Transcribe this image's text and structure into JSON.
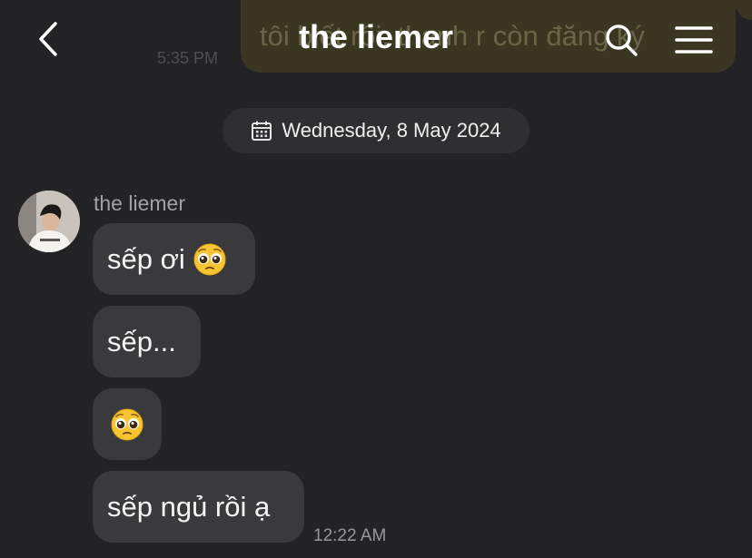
{
  "previous_message": {
    "text": "tôi biết rồi, thanh r còn đăng ký",
    "time": "5:35 PM"
  },
  "header": {
    "title": "the liemer",
    "back_icon": "chevron-left-icon",
    "search_icon": "search-icon",
    "menu_icon": "hamburger-menu-icon"
  },
  "date_separator": {
    "icon": "calendar-icon",
    "text": "Wednesday, 8 May 2024"
  },
  "conversation": {
    "sender_name": "the liemer",
    "messages": [
      {
        "text": "sếp ơi",
        "emoji": "pleading-face"
      },
      {
        "text": "sếp..."
      },
      {
        "text": "",
        "emoji": "pleading-face"
      },
      {
        "text": "sếp ngủ rồi ạ"
      }
    ],
    "last_time": "12:22 AM"
  },
  "colors": {
    "background": "#232325",
    "bubble": "#3a3a3c",
    "date_pill": "#2f2f31",
    "sender_name": "#a2a2a6",
    "timestamp": "#98989c",
    "previous_bubble": "#3a3622"
  }
}
